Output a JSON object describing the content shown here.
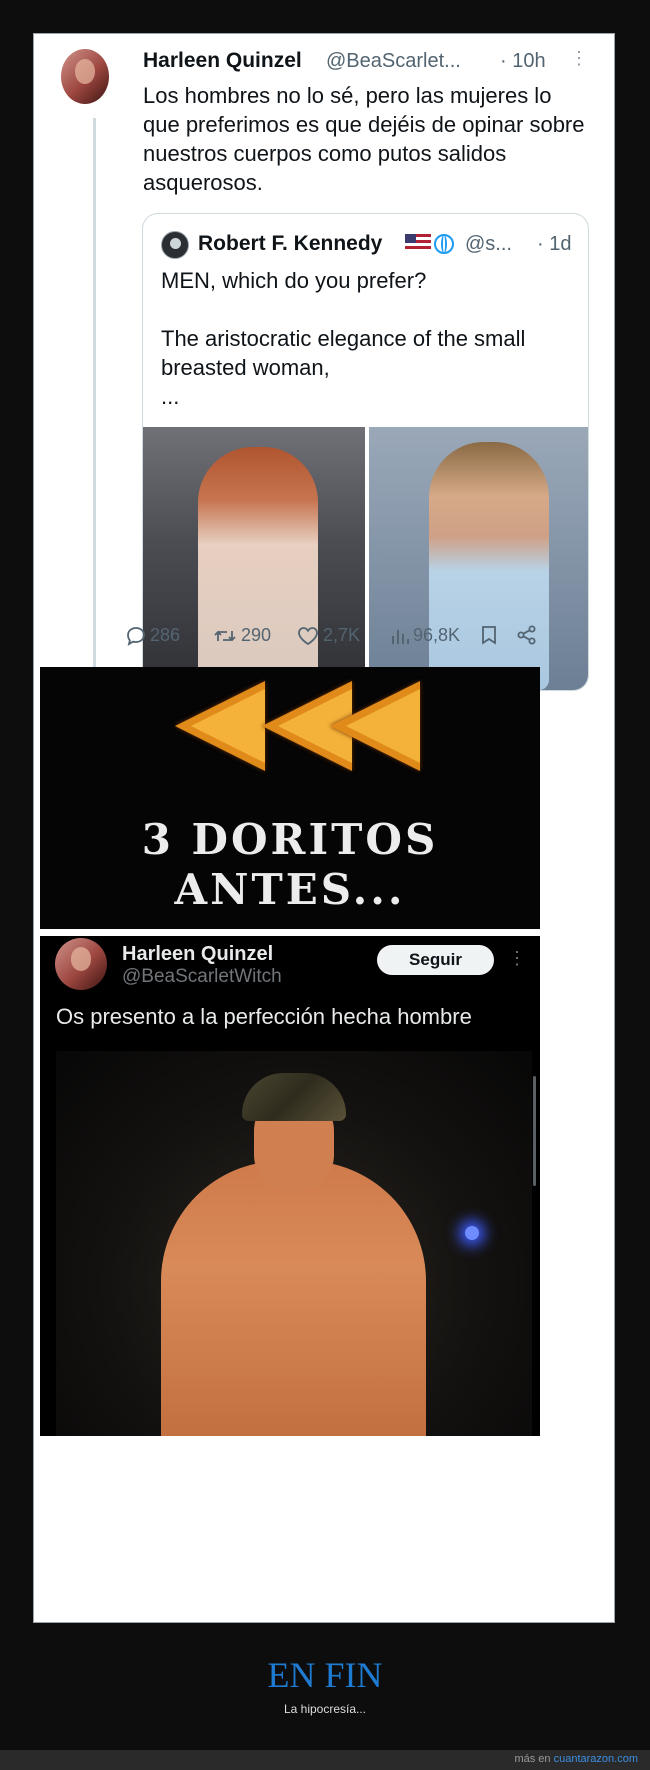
{
  "tweet": {
    "author_name": "Harleen Quinzel",
    "author_handle": "@BeaScarlet...",
    "time": "· 10h",
    "text": "Los hombres no lo sé, pero las mujeres lo que preferimos es que dejéis de opinar sobre nuestros cuerpos como putos salidos asquerosos.",
    "quoted": {
      "author_name": "Robert F. Kennedy",
      "author_handle": "@s...",
      "time": "· 1d",
      "text": "MEN, which do you prefer?\n\nThe aristocratic elegance of the small breasted woman,\n..."
    },
    "actions": {
      "replies": "286",
      "retweets": "290",
      "likes": "2,7K",
      "views": "96,8K"
    },
    "icons": [
      "reply-icon",
      "retweet-icon",
      "like-icon",
      "views-icon",
      "bookmark-icon",
      "share-icon",
      "us-flag-icon",
      "globe-icon"
    ]
  },
  "meme_panel": {
    "text": "3 DORITOS\nANTES..."
  },
  "dark_tweet": {
    "author_name": "Harleen Quinzel",
    "author_handle": "@BeaScarletWitch",
    "follow_label": "Seguir",
    "text": "Os presento a la perfección hecha hombre"
  },
  "footer": {
    "headline": "EN FIN",
    "subtitle": "La hipocresía...",
    "credit_prefix": "más en",
    "credit_link": "cuantarazon.com"
  },
  "colors": {
    "page_bg": "#0d0d0d",
    "card_bg": "#ffffff",
    "headline": "#1f7bd1",
    "link": "#3d8ee0",
    "muted_text": "#536471",
    "orange_chip": "#e08a1a"
  }
}
